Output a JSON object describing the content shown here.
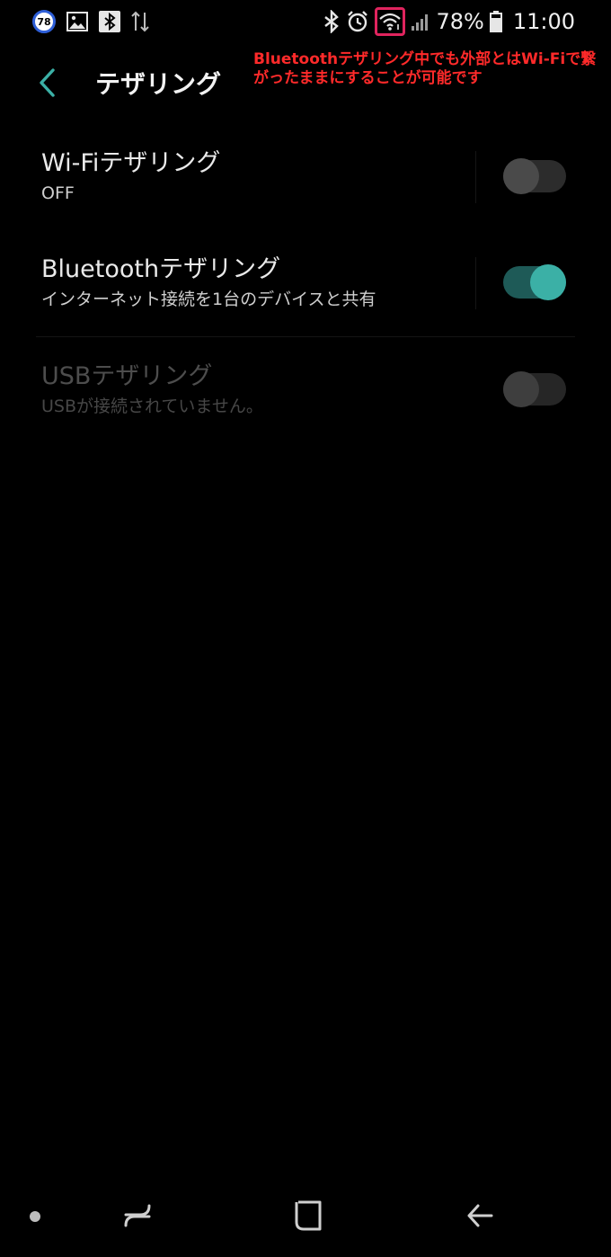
{
  "status_bar": {
    "badge_number": "78",
    "left_icons": [
      "photo-icon",
      "bluetooth-notification-icon",
      "data-transfer-icon"
    ],
    "right_icons": [
      "bluetooth-icon",
      "alarm-icon",
      "wifi-icon",
      "signal-icon",
      "battery-icon"
    ],
    "battery_percent": "78%",
    "time": "11:00",
    "highlight_color": "#e0245e"
  },
  "annotation": {
    "line1": "Bluetoothテザリング中でも外部とはWi-Fiで繋",
    "line2": "がったままにすることが可能です",
    "color": "#ff2a2a"
  },
  "header": {
    "title": "テザリング",
    "back_icon": "chevron-left-icon"
  },
  "settings": [
    {
      "title": "Wi-Fiテザリング",
      "subtitle": "OFF",
      "toggle_state": "off",
      "enabled": true
    },
    {
      "title": "Bluetoothテザリング",
      "subtitle": "インターネット接続を1台のデバイスと共有",
      "toggle_state": "on",
      "enabled": true
    },
    {
      "title": "USBテザリング",
      "subtitle": "USBが接続されていません。",
      "toggle_state": "off",
      "enabled": false
    }
  ],
  "colors": {
    "accent": "#3bb0a6",
    "accent_track": "#1e5a57",
    "background": "#000000"
  },
  "nav_bar": {
    "items": [
      "dot-indicator",
      "recent-apps-icon",
      "home-icon",
      "back-arrow-icon"
    ]
  }
}
